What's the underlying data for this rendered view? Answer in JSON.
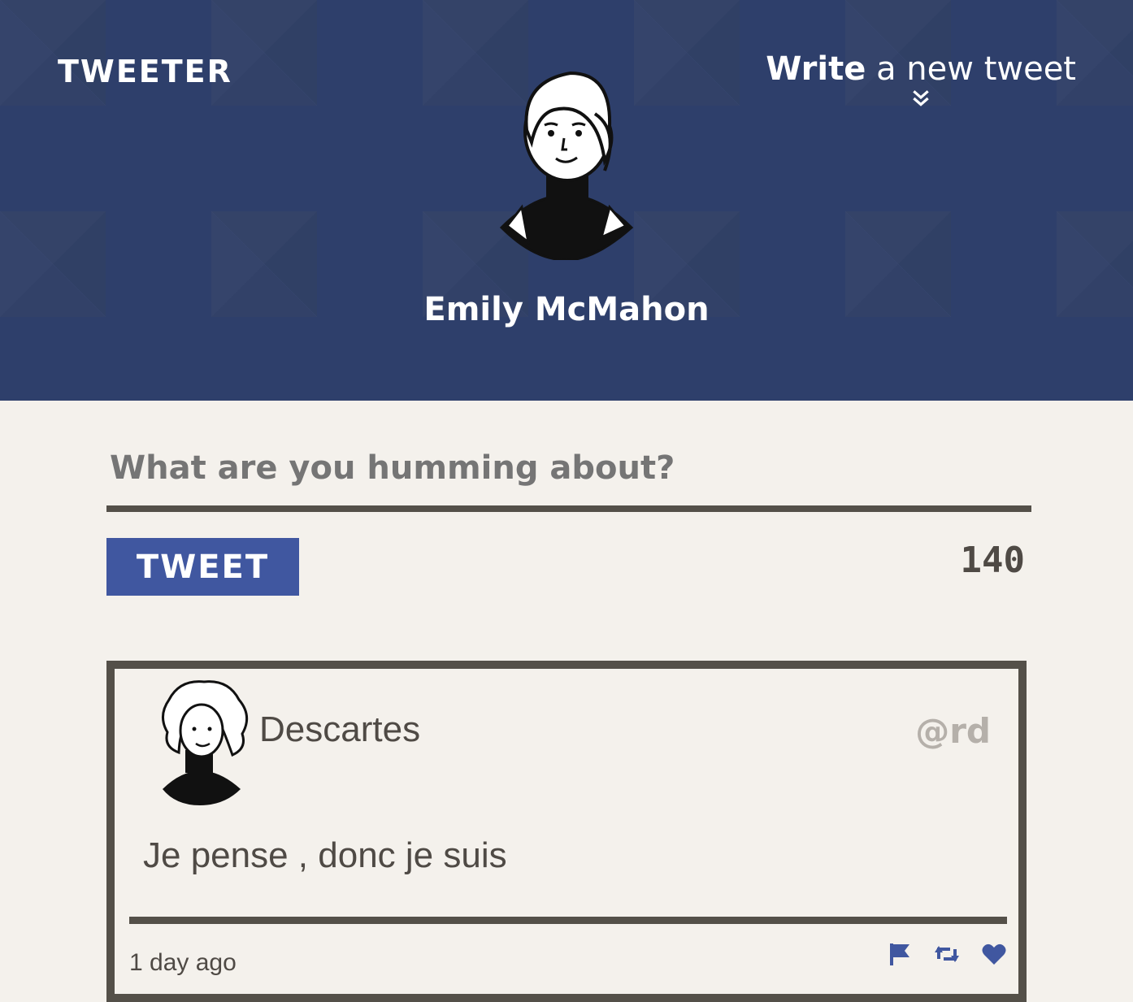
{
  "header": {
    "brand": "TWEETER",
    "compose_strong": "Write",
    "compose_rest": " a new tweet",
    "user_name": "Emily McMahon"
  },
  "composer": {
    "placeholder": "What are you humming about?",
    "button_label": "TWEET",
    "char_count": "140"
  },
  "tweets": [
    {
      "author": "Descartes",
      "handle": "@rd",
      "text": "Je pense , donc je suis",
      "timestamp": "1 day ago",
      "actions": [
        "flag-icon",
        "retweet-icon",
        "heart-icon"
      ]
    }
  ],
  "colors": {
    "hero_bg": "#2e3f6b",
    "accent": "#4057a0",
    "text": "#4f4a45",
    "border": "#545049",
    "page_bg": "#f4f1ec",
    "muted": "#b5b0aa"
  }
}
